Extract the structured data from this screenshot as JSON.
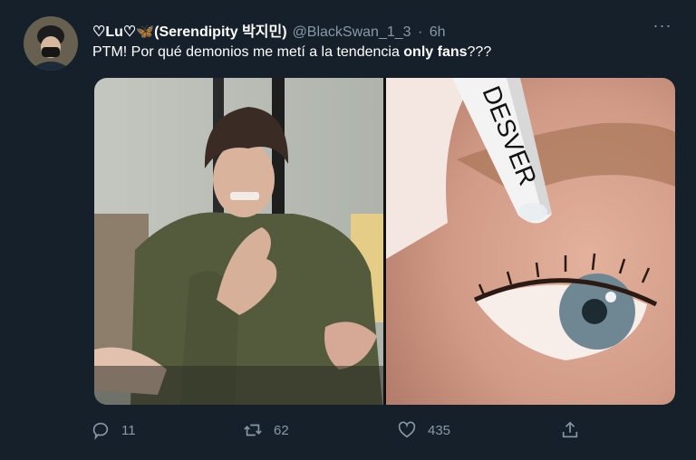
{
  "tweet": {
    "display_name": "♡Lu♡🦋(Serendipity 박지민)",
    "handle": "@BlackSwan_1_3",
    "separator": "·",
    "time": "6h",
    "more": "···",
    "text_before": "PTM! Por qué demonios me metí a la tendencia ",
    "text_bold": "only fans",
    "text_after": "???",
    "image_caption": "DESVER",
    "counts": {
      "replies": "11",
      "retweets": "62",
      "likes": "435"
    },
    "icons": {
      "reply": "reply-icon",
      "retweet": "retweet-icon",
      "like": "heart-icon",
      "share": "share-icon",
      "more": "more-icon"
    },
    "colors": {
      "background": "#15202b",
      "muted": "#8899a6",
      "text": "#ffffff"
    }
  }
}
